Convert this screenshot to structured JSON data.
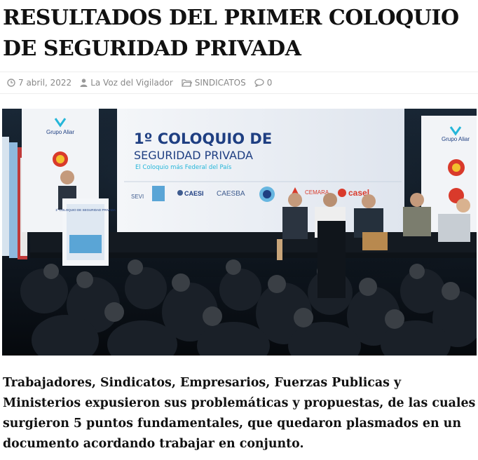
{
  "article": {
    "title": "RESULTADOS DEL PRIMER COLOQUIO DE SEGURIDAD PRIVADA",
    "lead": "Trabajadores, Sindicatos, Empresarios, Fuerzas Publicas y Ministerios expusieron sus problemáticas y propuestas, de las cuales surgieron 5 puntos fundamentales, que quedaron plasmados en un documento acordando trabajar en conjunto."
  },
  "meta": {
    "date": "7 abril, 2022",
    "author": "La Voz del Vigilador",
    "category": "SINDICATOS",
    "comments": "0",
    "icons": [
      "clock-icon",
      "user-icon",
      "folder-icon",
      "comment-icon"
    ],
    "icon_color": "#999999"
  },
  "photo": {
    "screen": {
      "heading_line1": "1º COLOQUIO DE",
      "heading_line2": "SEGURIDAD PRIVADA",
      "subheading": "El Coloquio más Federal del País",
      "sponsors": [
        "SEVI",
        "CAESI",
        "CAESBA",
        "CEMARA",
        "casel"
      ]
    },
    "side_banner_left": "Grupo Aliar",
    "side_banner_right": "Grupo Aliar",
    "podium_text": "1º COLOQUIO DE SEGURIDAD PRIVADA",
    "colors": {
      "screen_bg": "#e9edf3",
      "heading": "#1f3f82",
      "accent": "#25b6d9"
    }
  }
}
